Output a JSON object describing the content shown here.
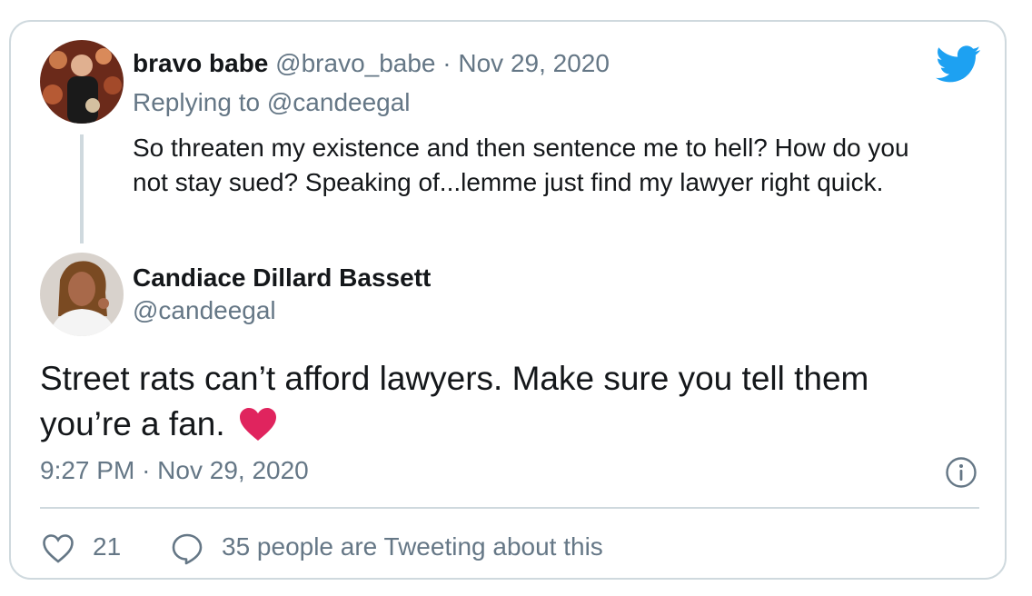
{
  "colors": {
    "twitter_blue": "#1da1f2",
    "text_primary": "#14171a",
    "text_secondary": "#657786",
    "border": "#cfd9de",
    "heart_red": "#e0245e"
  },
  "parent_tweet": {
    "display_name": "bravo babe",
    "handle": "@bravo_babe",
    "separator": "·",
    "date": "Nov 29, 2020",
    "replying_prefix": "Replying to",
    "replying_handle": "@candeegal",
    "text": "So threaten my existence and then sentence me to hell? How do you not stay sued? Speaking of...lemme just find my lawyer right quick."
  },
  "brand_icon": "twitter-bird-icon",
  "main_tweet": {
    "display_name": "Candiace Dillard Bassett",
    "handle": "@candeegal",
    "text": "Street rats can’t afford lawyers. Make sure you tell them you’re a fan.",
    "emoji": "red-heart-icon",
    "time": "9:27 PM",
    "separator": "·",
    "date": "Nov 29, 2020"
  },
  "actions": {
    "like_count": "21",
    "tweeting_about": "35 people are Tweeting about this"
  }
}
